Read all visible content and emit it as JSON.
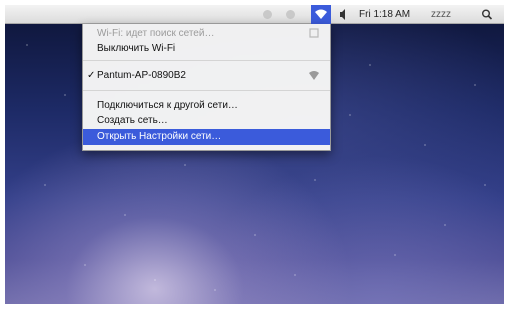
{
  "menubar": {
    "clock": "Fri 1:18 AM",
    "user": "zzzz",
    "icons": [
      "wifi-icon",
      "volume-icon",
      "spotlight-icon"
    ]
  },
  "wifi_menu": {
    "status": "Wi-Fi: идет поиск сетей…",
    "turn_off": "Выключить Wi-Fi",
    "network": "Pantum-AP-0890B2",
    "other_network": "Подключиться к другой сети…",
    "create_network": "Создать сеть…",
    "open_prefs": "Открыть Настройки сети…"
  },
  "colors": {
    "highlight": "#3b5bdb"
  }
}
